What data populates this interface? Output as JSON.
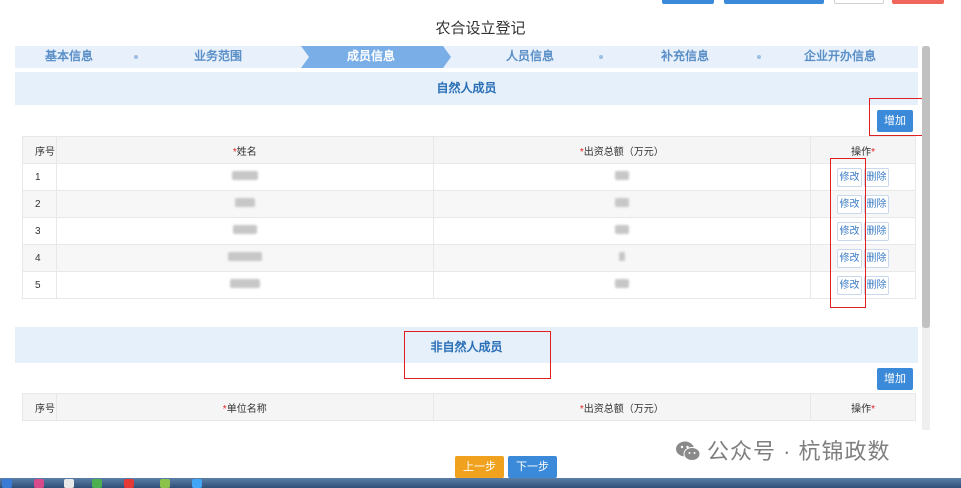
{
  "page": {
    "title": "农合设立登记"
  },
  "steps": [
    {
      "label": "基本信息",
      "active": false
    },
    {
      "label": "业务范围",
      "active": false
    },
    {
      "label": "成员信息",
      "active": true
    },
    {
      "label": "人员信息",
      "active": false
    },
    {
      "label": "补充信息",
      "active": false
    },
    {
      "label": "企业开办信息",
      "active": false
    }
  ],
  "natural_members": {
    "title": "自然人成员",
    "add_label": "增加",
    "headers": {
      "no": "序号",
      "name": "姓名",
      "amount": "出资总额（万元）",
      "op": "操作"
    },
    "rows": [
      {
        "no": "1",
        "edit": "修改",
        "delete": "删除"
      },
      {
        "no": "2",
        "edit": "修改",
        "delete": "删除"
      },
      {
        "no": "3",
        "edit": "修改",
        "delete": "删除"
      },
      {
        "no": "4",
        "edit": "修改",
        "delete": "删除"
      },
      {
        "no": "5",
        "edit": "修改",
        "delete": "删除"
      }
    ]
  },
  "non_natural_members": {
    "title": "非自然人成员",
    "add_label": "增加",
    "headers": {
      "no": "序号",
      "name": "单位名称",
      "amount": "出资总额（万元）",
      "op": "操作"
    }
  },
  "nav": {
    "prev_label": "上一步",
    "next_label": "下一步"
  },
  "watermark": {
    "text": "公众号 · 杭锦政数"
  },
  "colors": {
    "accent": "#3b8ad9",
    "highlight": "#e02020",
    "prev": "#f0a21e"
  }
}
